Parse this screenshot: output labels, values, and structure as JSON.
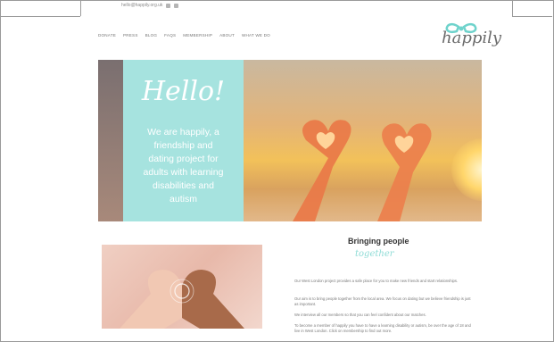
{
  "topbar": {
    "email": "hello@happily.org.uk",
    "icons": [
      "facebook-icon",
      "twitter-icon"
    ]
  },
  "nav": {
    "items": [
      "WHAT WE DO",
      "ABOUT",
      "MEMBERSHIP",
      "FAQS",
      "BLOG",
      "PRESS",
      "DONATE"
    ]
  },
  "logo": {
    "text": "happily",
    "icon": "bow-icon",
    "color": "#6fd3cc"
  },
  "hero": {
    "greeting": "Hello!",
    "lines": [
      "We are happily, a",
      "friendship and",
      "dating project for",
      "adults with learning",
      "disabilities and",
      "autism"
    ],
    "panel_color": "#a6e3df"
  },
  "section": {
    "title": "Bringing people",
    "script": "together",
    "paragraphs": [
      "Our West London project provides a safe place for you to make new friends and start relationships.",
      "Our aim is to bring people together from the local area. We focus on dating but we believe friendship is just as important.",
      "We interview all our members so that you can feel confident about our matches.",
      "To become a member of happily you have to have a learning disability or autism, be over the age of 18 and live in West London. Click on membership to find out more."
    ]
  }
}
